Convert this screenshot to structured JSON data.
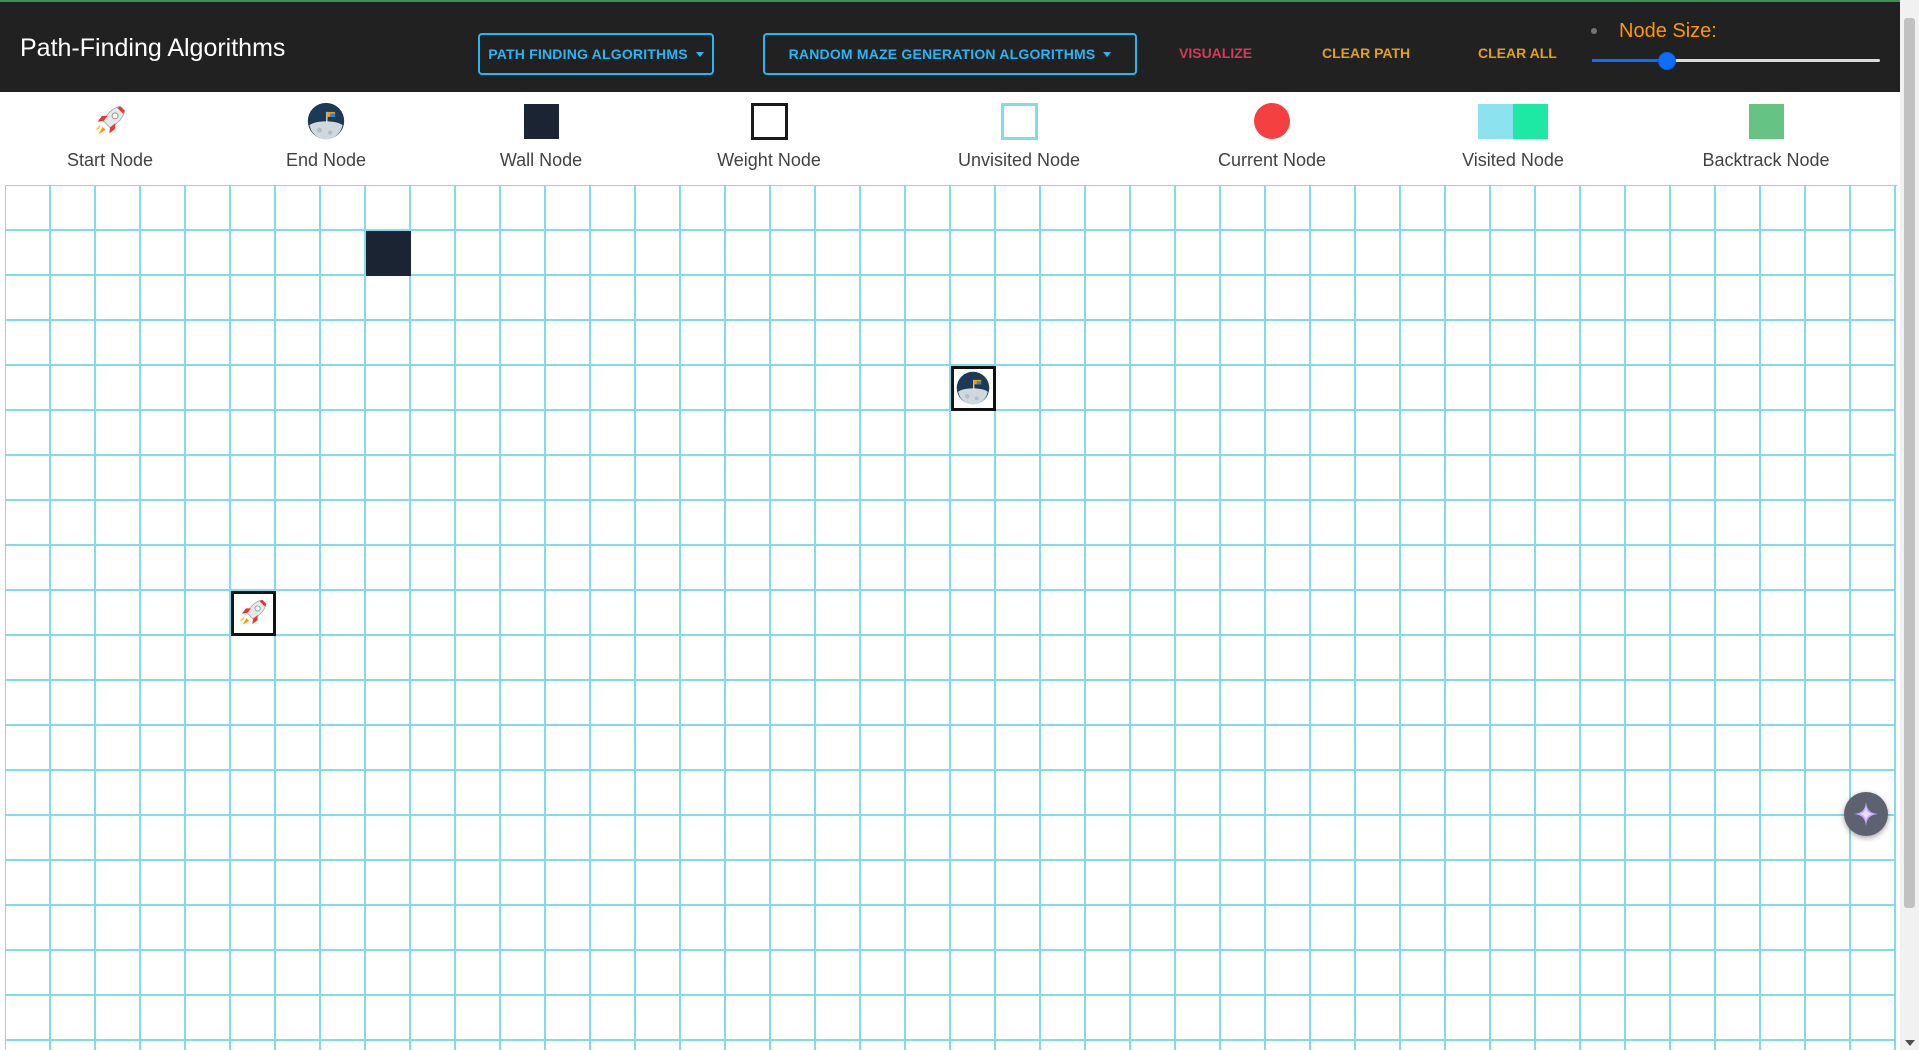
{
  "navbar": {
    "brand": "Path-Finding Algorithms",
    "path_finding_dropdown": "PATH FINDING ALGORITHMS",
    "maze_dropdown": "RANDOM MAZE GENERATION ALGORITHMS",
    "visualize": "VISUALIZE",
    "clear_path": "CLEAR PATH",
    "clear_all": "CLEAR ALL",
    "node_size_label": "Node Size:",
    "node_size_fraction": 0.26
  },
  "legend": [
    {
      "key": "start",
      "label": "Start Node",
      "icon": "rocket-icon"
    },
    {
      "key": "end",
      "label": "End Node",
      "icon": "moon-flag-icon"
    },
    {
      "key": "wall",
      "label": "Wall Node",
      "color": "#1a2433"
    },
    {
      "key": "weight",
      "label": "Weight Node",
      "color": "#1a1a1a"
    },
    {
      "key": "unvisited",
      "label": "Unvisited Node",
      "color": "#7fdce8"
    },
    {
      "key": "current",
      "label": "Current Node",
      "color": "#f44040"
    },
    {
      "key": "visited",
      "label": "Visited Node",
      "colors": [
        "#8de2f0",
        "#1de9a4"
      ]
    },
    {
      "key": "backtrack",
      "label": "Backtrack Node",
      "color": "#66c383"
    }
  ],
  "grid": {
    "cols": 42,
    "rows": 20,
    "start": {
      "row": 9,
      "col": 5
    },
    "end": {
      "row": 4,
      "col": 21
    },
    "walls": [
      {
        "row": 1,
        "col": 8
      }
    ]
  },
  "colors": {
    "navbar_bg": "#212121",
    "accent_blue": "#29b6f6",
    "visualize_red": "#d43a5a",
    "clear_orange": "#e0a020",
    "grid_line": "#7fdce8"
  }
}
